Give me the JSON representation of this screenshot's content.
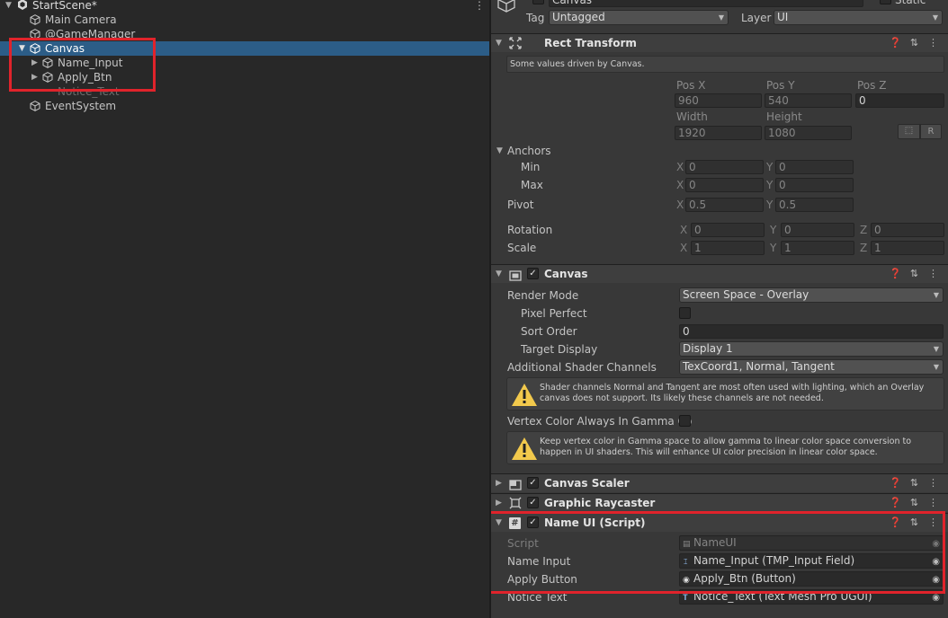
{
  "hierarchy": {
    "scene_name": "StartScene*",
    "items": [
      {
        "label": "Main Camera"
      },
      {
        "label": "@GameManager"
      },
      {
        "label": "Canvas"
      },
      {
        "label": "Name_Input"
      },
      {
        "label": "Apply_Btn"
      },
      {
        "label": "Notice_Text"
      },
      {
        "label": "EventSystem"
      }
    ]
  },
  "inspector": {
    "object_name": "Canvas",
    "static_label": "Static",
    "tag_label": "Tag",
    "tag_value": "Untagged",
    "layer_label": "Layer",
    "layer_value": "UI",
    "rect_transform": {
      "title": "Rect Transform",
      "info": "Some values driven by Canvas.",
      "pos_x_label": "Pos X",
      "pos_y_label": "Pos Y",
      "pos_z_label": "Pos Z",
      "pos_x": "960",
      "pos_y": "540",
      "pos_z": "0",
      "width_label": "Width",
      "height_label": "Height",
      "width": "1920",
      "height": "1080",
      "r_button": "R",
      "anchors_label": "Anchors",
      "min_label": "Min",
      "max_label": "Max",
      "min_x": "0",
      "min_y": "0",
      "max_x": "0",
      "max_y": "0",
      "pivot_label": "Pivot",
      "pivot_x": "0.5",
      "pivot_y": "0.5",
      "rotation_label": "Rotation",
      "rot_x": "0",
      "rot_y": "0",
      "rot_z": "0",
      "scale_label": "Scale",
      "scale_x": "1",
      "scale_y": "1",
      "scale_z": "1",
      "x": "X",
      "y": "Y",
      "z": "Z"
    },
    "canvas": {
      "title": "Canvas",
      "render_mode_label": "Render Mode",
      "render_mode": "Screen Space - Overlay",
      "pixel_perfect_label": "Pixel Perfect",
      "sort_order_label": "Sort Order",
      "sort_order": "0",
      "target_display_label": "Target Display",
      "target_display": "Display 1",
      "shader_channels_label": "Additional Shader Channels",
      "shader_channels": "TexCoord1, Normal, Tangent",
      "warning1": "Shader channels Normal and Tangent are most often used with lighting, which an Overlay canvas does not support. Its likely these channels are not needed.",
      "vertex_color_label": "Vertex Color Always In Gamma Co",
      "warning2": "Keep vertex color in Gamma space to allow gamma to linear color space conversion to happen in UI shaders. This will enhance UI color precision in linear color space."
    },
    "canvas_scaler": {
      "title": "Canvas Scaler"
    },
    "graphic_raycaster": {
      "title": "Graphic Raycaster"
    },
    "name_ui": {
      "title": "Name UI (Script)",
      "script_label": "Script",
      "script_value": "NameUI",
      "name_input_label": "Name Input",
      "name_input_value": "Name_Input (TMP_Input Field)",
      "apply_button_label": "Apply Button",
      "apply_button_value": "Apply_Btn (Button)",
      "notice_text_label": "Notice Text",
      "notice_text_value": "Notice_Text (Text Mesh Pro UGUI)"
    }
  },
  "colors": {
    "highlight_box": "#e0232b",
    "selection": "#2c5d87"
  }
}
